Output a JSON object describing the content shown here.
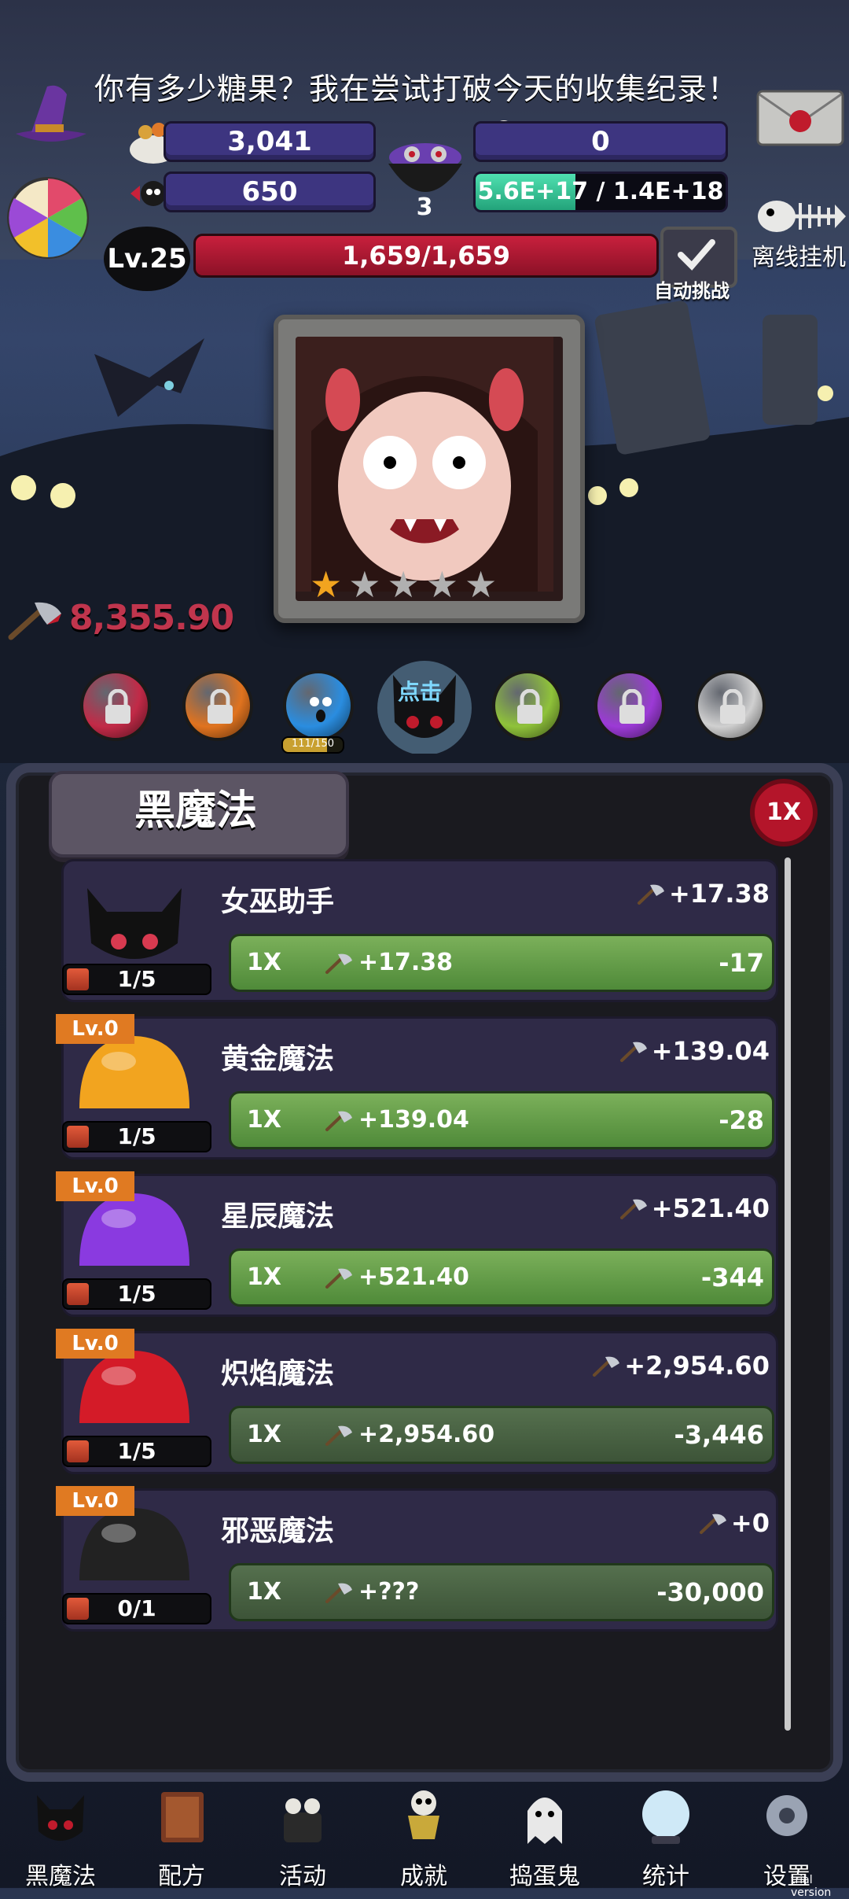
{
  "header": {
    "speech": "你有多少糖果？我在尝试打破今天的收集纪录！",
    "candy_amount": "3,041",
    "bone_amount": "0",
    "skull_candy_amount": "650",
    "cauldron_count": "3",
    "growth_text": "5.6E+17 / 1.4E+18",
    "growth_fraction": 0.4,
    "offline_label": "离线挂机",
    "level": "Lv.25",
    "hp_text": "1,659/1,659",
    "hp_fraction": 1.0,
    "auto_label": "自动挑战"
  },
  "scene": {
    "character_stars": 1,
    "character_stars_max": 5,
    "damage": "8,355.90",
    "orb_progress_text": "111/150",
    "orb_progress_fraction": 0.74,
    "click_label": "点击",
    "orbs": [
      {
        "color": "#c22a47",
        "locked": true
      },
      {
        "color": "#e0731f",
        "locked": true
      },
      {
        "color": "#2a8de0",
        "locked": false
      },
      {
        "color": "#111111",
        "locked": false
      },
      {
        "color": "#8fc23a",
        "locked": true
      },
      {
        "color": "#9c3ad6",
        "locked": true
      },
      {
        "color": "#d0d0d0",
        "locked": true
      }
    ]
  },
  "panel": {
    "title": "黑魔法",
    "multiplier": "1X",
    "rows": [
      {
        "name": "女巫助手",
        "dps": "+17.38",
        "btn_mult": "1X",
        "btn_gain": "+17.38",
        "btn_cost": "-17",
        "count": "1/5",
        "level": "",
        "color": "#111111"
      },
      {
        "name": "黄金魔法",
        "dps": "+139.04",
        "btn_mult": "1X",
        "btn_gain": "+139.04",
        "btn_cost": "-28",
        "count": "1/5",
        "level": "Lv.0",
        "color": "#f2a41f"
      },
      {
        "name": "星辰魔法",
        "dps": "+521.40",
        "btn_mult": "1X",
        "btn_gain": "+521.40",
        "btn_cost": "-344",
        "count": "1/5",
        "level": "Lv.0",
        "color": "#8a3ae0"
      },
      {
        "name": "炽焰魔法",
        "dps": "+2,954.60",
        "btn_mult": "1X",
        "btn_gain": "+2,954.60",
        "btn_cost": "-3,446",
        "count": "1/5",
        "level": "Lv.0",
        "color": "#d41b28"
      },
      {
        "name": "邪恶魔法",
        "dps": "+0",
        "btn_mult": "1X",
        "btn_gain": "+???",
        "btn_cost": "-30,000",
        "count": "0/1",
        "level": "Lv.0",
        "color": "#222222"
      }
    ]
  },
  "nav": [
    {
      "label": "黑魔法",
      "icon": "black-magic-icon"
    },
    {
      "label": "配方",
      "icon": "recipe-book-icon"
    },
    {
      "label": "活动",
      "icon": "event-cake-icon"
    },
    {
      "label": "成就",
      "icon": "trophy-skull-icon"
    },
    {
      "label": "捣蛋鬼",
      "icon": "ghost-icon"
    },
    {
      "label": "统计",
      "icon": "crystal-ball-icon"
    },
    {
      "label": "设置",
      "icon": "gear-icon"
    }
  ],
  "footer": {
    "trial": "trial version"
  }
}
